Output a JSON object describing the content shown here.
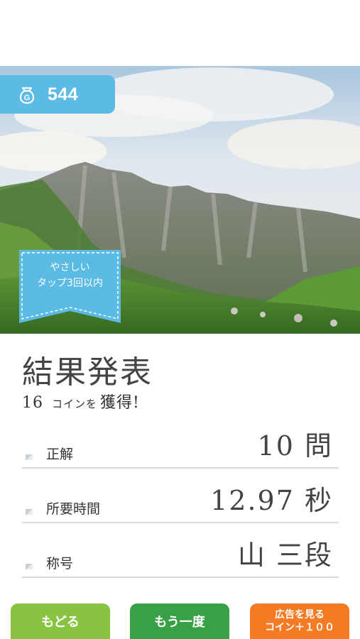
{
  "header": {
    "coins": "544",
    "coin_icon": "coin-bag-icon"
  },
  "ribbon": {
    "line1": "やさしい",
    "line2": "タップ3回以内"
  },
  "result": {
    "title": "結果発表",
    "reward_number": "16",
    "reward_unit": "コインを",
    "reward_suffix": "獲得!"
  },
  "stats": [
    {
      "label": "正解",
      "value": "10 問"
    },
    {
      "label": "所要時間",
      "value": "12.97 秒"
    },
    {
      "label": "称号",
      "value": "山 三段"
    }
  ],
  "buttons": {
    "back": "もどる",
    "retry": "もう一度",
    "ad_line1": "広告を見る",
    "ad_line2": "コイン＋１００"
  },
  "colors": {
    "coin_badge": "#5bbbe4",
    "ribbon": "#5bbbe4",
    "back_button": "#88c441",
    "retry_button": "#3aa045",
    "ad_button": "#f47a24"
  }
}
